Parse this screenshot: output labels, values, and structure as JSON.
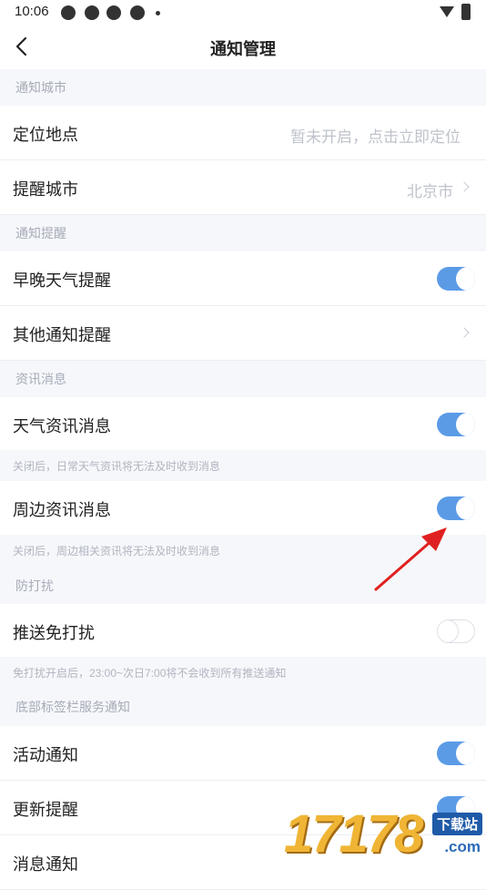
{
  "status_bar": {
    "time": "10:06"
  },
  "header": {
    "title": "通知管理"
  },
  "sections": [
    {
      "header": "通知城市"
    },
    {
      "header": "通知提醒"
    },
    {
      "header": "资讯消息"
    },
    {
      "header": "防打扰"
    },
    {
      "header": "底部标签栏服务通知"
    }
  ],
  "rows": {
    "location": {
      "label": "定位地点",
      "value": "暂未开启，点击立即定位"
    },
    "remind_city": {
      "label": "提醒城市",
      "value": "北京市"
    },
    "morning_evening": {
      "label": "早晚天气提醒",
      "enabled": true
    },
    "other_notice": {
      "label": "其他通知提醒"
    },
    "weather_news": {
      "label": "天气资讯消息",
      "enabled": true,
      "note": "关闭后，日常天气资讯将无法及时收到消息"
    },
    "nearby_news": {
      "label": "周边资讯消息",
      "enabled": true,
      "note": "关闭后，周边相关资讯将无法及时收到消息"
    },
    "push_dnd": {
      "label": "推送免打扰",
      "enabled": false,
      "note": "免打扰开启后，23:00~次日7:00将不会收到所有推送通知"
    },
    "activity": {
      "label": "活动通知",
      "enabled": true
    },
    "update": {
      "label": "更新提醒",
      "enabled": true
    },
    "message": {
      "label": "消息通知"
    }
  },
  "watermark": {
    "number": "17178",
    "badge": "下载站",
    "domain": ".com"
  },
  "colors": {
    "toggle_on": "#5b9be6",
    "arrow": "#e02020",
    "background": "#f6f7fb"
  }
}
